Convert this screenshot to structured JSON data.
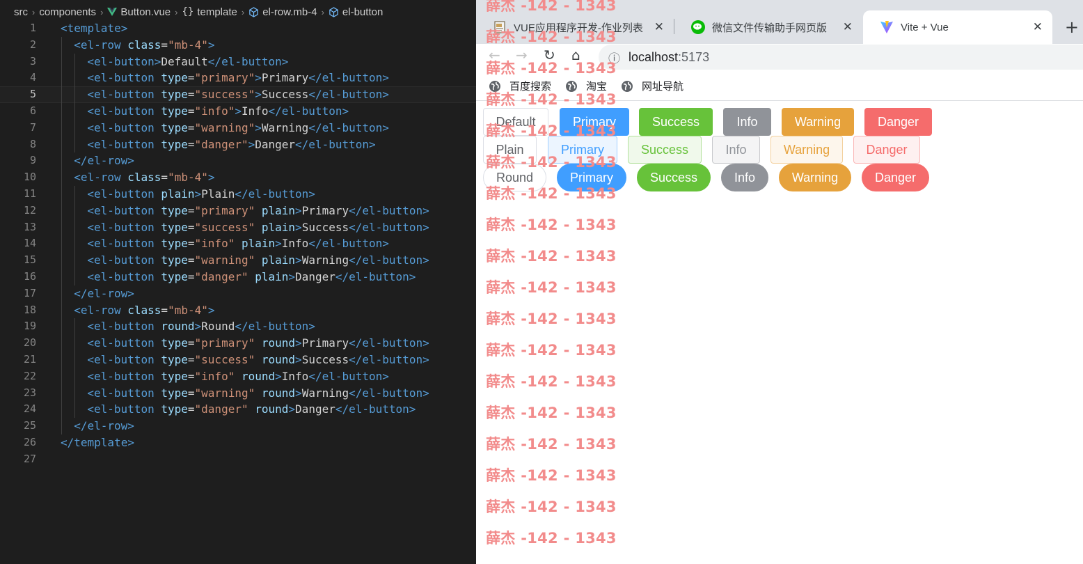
{
  "colors": {
    "primary": "#409eff",
    "success": "#67c23a",
    "info": "#909399",
    "warning": "#e6a23c",
    "danger": "#f56c6c",
    "primary_light": "#ecf5ff",
    "success_light": "#f0f9eb",
    "info_light": "#f4f4f5",
    "warning_light": "#fdf6ec",
    "danger_light": "#fef0f0",
    "primary_border": "#a0cfff",
    "success_border": "#b3e19d",
    "info_border": "#c8c9cc",
    "warning_border": "#f3d19e",
    "danger_border": "#fab6b6",
    "vue_green": "#41b883",
    "wechat_green": "#09bb07"
  },
  "editor": {
    "breadcrumb": [
      {
        "label": "src",
        "icon": ""
      },
      {
        "label": "components",
        "icon": ""
      },
      {
        "label": "Button.vue",
        "icon": "vue-logo-icon"
      },
      {
        "label": "template",
        "icon": "braces-icon"
      },
      {
        "label": "el-row.mb-4",
        "icon": "cube-icon"
      },
      {
        "label": "el-button",
        "icon": "cube-icon"
      }
    ],
    "current_line": 5,
    "lines": [
      {
        "n": "1",
        "indent": 0,
        "tokens": [
          [
            "tag",
            "<template>"
          ]
        ]
      },
      {
        "n": "2",
        "indent": 1,
        "tokens": [
          [
            "tag",
            "<el-row "
          ],
          [
            "attr",
            "class"
          ],
          [
            "txt",
            "="
          ],
          [
            "str",
            "\"mb-4\""
          ],
          [
            "tag",
            ">"
          ]
        ]
      },
      {
        "n": "3",
        "indent": 2,
        "tokens": [
          [
            "tag",
            "<el-button>"
          ],
          [
            "txt",
            "Default"
          ],
          [
            "tag",
            "</el-button>"
          ]
        ]
      },
      {
        "n": "4",
        "indent": 2,
        "tokens": [
          [
            "tag",
            "<el-button "
          ],
          [
            "attr",
            "type"
          ],
          [
            "txt",
            "="
          ],
          [
            "str",
            "\"primary\""
          ],
          [
            "tag",
            ">"
          ],
          [
            "txt",
            "Primary"
          ],
          [
            "tag",
            "</el-button>"
          ]
        ]
      },
      {
        "n": "5",
        "indent": 2,
        "tokens": [
          [
            "tag",
            "<el-button "
          ],
          [
            "attr",
            "type"
          ],
          [
            "txt",
            "="
          ],
          [
            "str",
            "\"success\""
          ],
          [
            "tag",
            ">"
          ],
          [
            "txt",
            "Success"
          ],
          [
            "tag",
            "</el-button>"
          ]
        ]
      },
      {
        "n": "6",
        "indent": 2,
        "tokens": [
          [
            "tag",
            "<el-button "
          ],
          [
            "attr",
            "type"
          ],
          [
            "txt",
            "="
          ],
          [
            "str",
            "\"info\""
          ],
          [
            "tag",
            ">"
          ],
          [
            "txt",
            "Info"
          ],
          [
            "tag",
            "</el-button>"
          ]
        ]
      },
      {
        "n": "7",
        "indent": 2,
        "tokens": [
          [
            "tag",
            "<el-button "
          ],
          [
            "attr",
            "type"
          ],
          [
            "txt",
            "="
          ],
          [
            "str",
            "\"warning\""
          ],
          [
            "tag",
            ">"
          ],
          [
            "txt",
            "Warning"
          ],
          [
            "tag",
            "</el-button>"
          ]
        ]
      },
      {
        "n": "8",
        "indent": 2,
        "tokens": [
          [
            "tag",
            "<el-button "
          ],
          [
            "attr",
            "type"
          ],
          [
            "txt",
            "="
          ],
          [
            "str",
            "\"danger\""
          ],
          [
            "tag",
            ">"
          ],
          [
            "txt",
            "Danger"
          ],
          [
            "tag",
            "</el-button>"
          ]
        ]
      },
      {
        "n": "9",
        "indent": 1,
        "tokens": [
          [
            "tag",
            "</el-row>"
          ]
        ]
      },
      {
        "n": "10",
        "indent": 1,
        "tokens": [
          [
            "tag",
            "<el-row "
          ],
          [
            "attr",
            "class"
          ],
          [
            "txt",
            "="
          ],
          [
            "str",
            "\"mb-4\""
          ],
          [
            "tag",
            ">"
          ]
        ]
      },
      {
        "n": "11",
        "indent": 2,
        "tokens": [
          [
            "tag",
            "<el-button "
          ],
          [
            "attr",
            "plain"
          ],
          [
            "tag",
            ">"
          ],
          [
            "txt",
            "Plain"
          ],
          [
            "tag",
            "</el-button>"
          ]
        ]
      },
      {
        "n": "12",
        "indent": 2,
        "tokens": [
          [
            "tag",
            "<el-button "
          ],
          [
            "attr",
            "type"
          ],
          [
            "txt",
            "="
          ],
          [
            "str",
            "\"primary\""
          ],
          [
            "txt",
            " "
          ],
          [
            "attr",
            "plain"
          ],
          [
            "tag",
            ">"
          ],
          [
            "txt",
            "Primary"
          ],
          [
            "tag",
            "</el-button>"
          ]
        ]
      },
      {
        "n": "13",
        "indent": 2,
        "tokens": [
          [
            "tag",
            "<el-button "
          ],
          [
            "attr",
            "type"
          ],
          [
            "txt",
            "="
          ],
          [
            "str",
            "\"success\""
          ],
          [
            "txt",
            " "
          ],
          [
            "attr",
            "plain"
          ],
          [
            "tag",
            ">"
          ],
          [
            "txt",
            "Success"
          ],
          [
            "tag",
            "</el-button>"
          ]
        ]
      },
      {
        "n": "14",
        "indent": 2,
        "tokens": [
          [
            "tag",
            "<el-button "
          ],
          [
            "attr",
            "type"
          ],
          [
            "txt",
            "="
          ],
          [
            "str",
            "\"info\""
          ],
          [
            "txt",
            " "
          ],
          [
            "attr",
            "plain"
          ],
          [
            "tag",
            ">"
          ],
          [
            "txt",
            "Info"
          ],
          [
            "tag",
            "</el-button>"
          ]
        ]
      },
      {
        "n": "15",
        "indent": 2,
        "tokens": [
          [
            "tag",
            "<el-button "
          ],
          [
            "attr",
            "type"
          ],
          [
            "txt",
            "="
          ],
          [
            "str",
            "\"warning\""
          ],
          [
            "txt",
            " "
          ],
          [
            "attr",
            "plain"
          ],
          [
            "tag",
            ">"
          ],
          [
            "txt",
            "Warning"
          ],
          [
            "tag",
            "</el-button>"
          ]
        ]
      },
      {
        "n": "16",
        "indent": 2,
        "tokens": [
          [
            "tag",
            "<el-button "
          ],
          [
            "attr",
            "type"
          ],
          [
            "txt",
            "="
          ],
          [
            "str",
            "\"danger\""
          ],
          [
            "txt",
            " "
          ],
          [
            "attr",
            "plain"
          ],
          [
            "tag",
            ">"
          ],
          [
            "txt",
            "Danger"
          ],
          [
            "tag",
            "</el-button>"
          ]
        ]
      },
      {
        "n": "17",
        "indent": 1,
        "tokens": [
          [
            "tag",
            "</el-row>"
          ]
        ]
      },
      {
        "n": "18",
        "indent": 1,
        "tokens": [
          [
            "tag",
            "<el-row "
          ],
          [
            "attr",
            "class"
          ],
          [
            "txt",
            "="
          ],
          [
            "str",
            "\"mb-4\""
          ],
          [
            "tag",
            ">"
          ]
        ]
      },
      {
        "n": "19",
        "indent": 2,
        "tokens": [
          [
            "tag",
            "<el-button "
          ],
          [
            "attr",
            "round"
          ],
          [
            "tag",
            ">"
          ],
          [
            "txt",
            "Round"
          ],
          [
            "tag",
            "</el-button>"
          ]
        ]
      },
      {
        "n": "20",
        "indent": 2,
        "tokens": [
          [
            "tag",
            "<el-button "
          ],
          [
            "attr",
            "type"
          ],
          [
            "txt",
            "="
          ],
          [
            "str",
            "\"primary\""
          ],
          [
            "txt",
            " "
          ],
          [
            "attr",
            "round"
          ],
          [
            "tag",
            ">"
          ],
          [
            "txt",
            "Primary"
          ],
          [
            "tag",
            "</el-button>"
          ]
        ]
      },
      {
        "n": "21",
        "indent": 2,
        "tokens": [
          [
            "tag",
            "<el-button "
          ],
          [
            "attr",
            "type"
          ],
          [
            "txt",
            "="
          ],
          [
            "str",
            "\"success\""
          ],
          [
            "txt",
            " "
          ],
          [
            "attr",
            "round"
          ],
          [
            "tag",
            ">"
          ],
          [
            "txt",
            "Success"
          ],
          [
            "tag",
            "</el-button>"
          ]
        ]
      },
      {
        "n": "22",
        "indent": 2,
        "tokens": [
          [
            "tag",
            "<el-button "
          ],
          [
            "attr",
            "type"
          ],
          [
            "txt",
            "="
          ],
          [
            "str",
            "\"info\""
          ],
          [
            "txt",
            " "
          ],
          [
            "attr",
            "round"
          ],
          [
            "tag",
            ">"
          ],
          [
            "txt",
            "Info"
          ],
          [
            "tag",
            "</el-button>"
          ]
        ]
      },
      {
        "n": "23",
        "indent": 2,
        "tokens": [
          [
            "tag",
            "<el-button "
          ],
          [
            "attr",
            "type"
          ],
          [
            "txt",
            "="
          ],
          [
            "str",
            "\"warning\""
          ],
          [
            "txt",
            " "
          ],
          [
            "attr",
            "round"
          ],
          [
            "tag",
            ">"
          ],
          [
            "txt",
            "Warning"
          ],
          [
            "tag",
            "</el-button>"
          ]
        ]
      },
      {
        "n": "24",
        "indent": 2,
        "tokens": [
          [
            "tag",
            "<el-button "
          ],
          [
            "attr",
            "type"
          ],
          [
            "txt",
            "="
          ],
          [
            "str",
            "\"danger\""
          ],
          [
            "txt",
            " "
          ],
          [
            "attr",
            "round"
          ],
          [
            "tag",
            ">"
          ],
          [
            "txt",
            "Danger"
          ],
          [
            "tag",
            "</el-button>"
          ]
        ]
      },
      {
        "n": "25",
        "indent": 1,
        "tokens": [
          [
            "tag",
            "</el-row>"
          ]
        ]
      },
      {
        "n": "26",
        "indent": 0,
        "tokens": [
          [
            "tag",
            "</template>"
          ]
        ]
      },
      {
        "n": "27",
        "indent": 0,
        "tokens": []
      }
    ]
  },
  "browser": {
    "tabs": [
      {
        "title": "VUE应用程序开发-作业列表",
        "icon": "document-icon",
        "active": false
      },
      {
        "title": "微信文件传输助手网页版",
        "icon": "wechat-icon",
        "active": false
      },
      {
        "title": "Vite + Vue",
        "icon": "vite-logo-icon",
        "active": true
      }
    ],
    "tab_close_symbol": "✕",
    "new_tab_symbol": "+",
    "nav": {
      "back": "←",
      "forward": "→",
      "reload": "↻",
      "home": "⌂"
    },
    "address": {
      "info_symbol": "ⓘ",
      "host": "localhost",
      "port": ":5173"
    },
    "bookmarks": [
      "百度搜索",
      "淘宝",
      "网址导航"
    ],
    "button_rows": [
      {
        "variant": "solid",
        "buttons": [
          {
            "label": "Default",
            "type": "default"
          },
          {
            "label": "Primary",
            "type": "primary"
          },
          {
            "label": "Success",
            "type": "success"
          },
          {
            "label": "Info",
            "type": "info"
          },
          {
            "label": "Warning",
            "type": "warning"
          },
          {
            "label": "Danger",
            "type": "danger"
          }
        ]
      },
      {
        "variant": "plain",
        "buttons": [
          {
            "label": "Plain",
            "type": "default"
          },
          {
            "label": "Primary",
            "type": "primary"
          },
          {
            "label": "Success",
            "type": "success"
          },
          {
            "label": "Info",
            "type": "info"
          },
          {
            "label": "Warning",
            "type": "warning"
          },
          {
            "label": "Danger",
            "type": "danger"
          }
        ]
      },
      {
        "variant": "round",
        "buttons": [
          {
            "label": "Round",
            "type": "default"
          },
          {
            "label": "Primary",
            "type": "primary"
          },
          {
            "label": "Success",
            "type": "success"
          },
          {
            "label": "Info",
            "type": "info"
          },
          {
            "label": "Warning",
            "type": "warning"
          },
          {
            "label": "Danger",
            "type": "danger"
          }
        ]
      }
    ],
    "watermark": {
      "text": "薛杰 -142 - 1343",
      "count": 18
    }
  }
}
